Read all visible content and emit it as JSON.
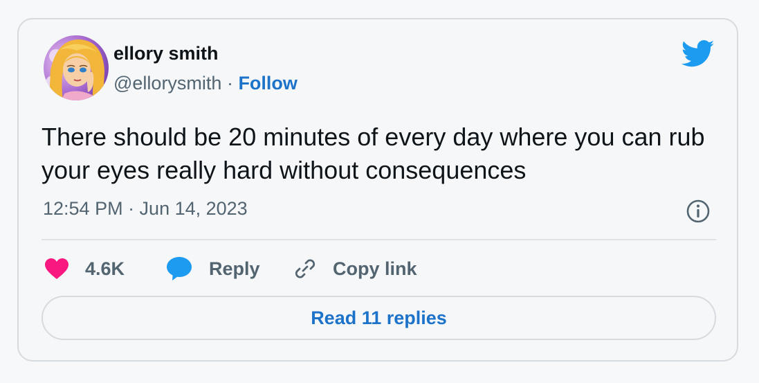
{
  "author": {
    "name": "ellory smith",
    "handle": "@ellorysmith",
    "separator": " · ",
    "follow_label": "Follow"
  },
  "tweet": {
    "text": "There should be 20 minutes of every day where you can rub your eyes really hard without consequences",
    "timestamp": "12:54 PM · Jun 14, 2023"
  },
  "actions": {
    "like_count": "4.6K",
    "reply_label": "Reply",
    "copy_link_label": "Copy link",
    "read_replies_label": "Read 11 replies"
  },
  "icons": {
    "brand": "twitter-bird-icon",
    "info": "info-icon",
    "like": "heart-icon",
    "reply": "speech-bubble-icon",
    "copy": "link-icon"
  },
  "colors": {
    "brand_blue": "#1d9bf0",
    "link_blue": "#1d73c9",
    "heart_pink": "#f91880",
    "text_primary": "#0f1419",
    "text_secondary": "#536471"
  }
}
